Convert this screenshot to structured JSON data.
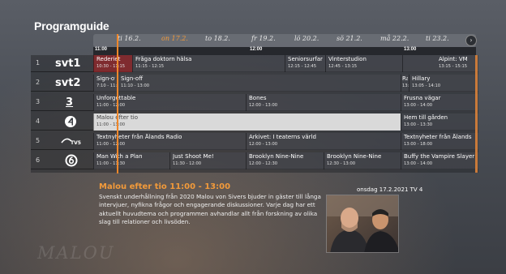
{
  "header": {
    "title": "Programguide"
  },
  "dates": [
    {
      "label": "ti 16.2.",
      "active": false
    },
    {
      "label": "on 17.2.",
      "active": true
    },
    {
      "label": "to 18.2.",
      "active": false
    },
    {
      "label": "fr 19.2.",
      "active": false
    },
    {
      "label": "lö 20.2.",
      "active": false
    },
    {
      "label": "sö 21.2.",
      "active": false
    },
    {
      "label": "må 22.2.",
      "active": false
    },
    {
      "label": "ti 23.2.",
      "active": false
    }
  ],
  "timeline": {
    "t1": "11:00",
    "t2": "12:00",
    "t3": "13:00"
  },
  "channels": [
    {
      "num": "1",
      "logo": "svt1",
      "programs": [
        {
          "title": "Rederiet",
          "time": "10:30 - 11:15",
          "past": true
        },
        {
          "title": "Fråga doktorn hälsa",
          "time": "11:15 - 12:15"
        },
        {
          "title": "Seniorsurfarna",
          "time": "12:15 - 12:45"
        },
        {
          "title": "Vinterstudion",
          "time": "12:45 - 13:15"
        },
        {
          "title": "Alpint: VM",
          "time": "13:15 - 15:15"
        }
      ]
    },
    {
      "num": "2",
      "logo": "svt2",
      "programs": [
        {
          "title": "Sign-off",
          "time": "7:10 - 11:",
          "past": true
        },
        {
          "title": "Sign-off",
          "time": "11:10 - 13:00"
        },
        {
          "title": "Rap",
          "time": "13:00"
        },
        {
          "title": "Hillary",
          "time": "13:05 - 14:10"
        }
      ]
    },
    {
      "num": "3",
      "logo": "3",
      "programs": [
        {
          "title": "Unforgettable",
          "time": "11:00 - 12:00"
        },
        {
          "title": "Bones",
          "time": "12:00 - 13:00"
        },
        {
          "title": "Frusna vägar",
          "time": "13:00 - 14:00"
        }
      ]
    },
    {
      "num": "4",
      "logo": "4",
      "programs": [
        {
          "title": "Malou efter tio",
          "time": "11:00 - 13:00",
          "selected": true
        },
        {
          "title": "Hem till gården",
          "time": "13:00 - 13:30"
        }
      ]
    },
    {
      "num": "5",
      "logo": "TV5",
      "programs": [
        {
          "title": "Textnyheter från Ålands Radio",
          "time": "11:00 - 12:00"
        },
        {
          "title": "Arkivet: I teaterns värld",
          "time": "12:00 - 13:00"
        },
        {
          "title": "Textnyheter från Ålands",
          "time": "13:00 - 18:00"
        }
      ]
    },
    {
      "num": "6",
      "logo": "6",
      "programs": [
        {
          "title": "Man With a Plan",
          "time": "11:00 - 11:30"
        },
        {
          "title": "Just Shoot Me!",
          "time": "11:30 - 12:00"
        },
        {
          "title": "Brooklyn Nine-Nine",
          "time": "12:00 - 12:30"
        },
        {
          "title": "Brooklyn Nine-Nine",
          "time": "12:30 - 13:00"
        },
        {
          "title": "Buffy the Vampire Slayer",
          "time": "13:00 - 14:00"
        }
      ]
    }
  ],
  "detail": {
    "title": "Malou efter tio 11:00 - 13:00",
    "description": "Svenskt underhållning från 2020 Malou von Sivers bjuder in gäster till långa intervjuer, nyfikna frågor och engagerande diskussioner. Varje dag har ett aktuellt huvudtema och programmen avhandlar allt från forskning av olika slag till relationer och livsöden.",
    "meta": "onsdag 17.2.2021 TV 4"
  },
  "watermark": "MALOU",
  "colors": {
    "accent": "#f29a3a",
    "past": "#9b2326",
    "selected": "#d9d9d9"
  }
}
